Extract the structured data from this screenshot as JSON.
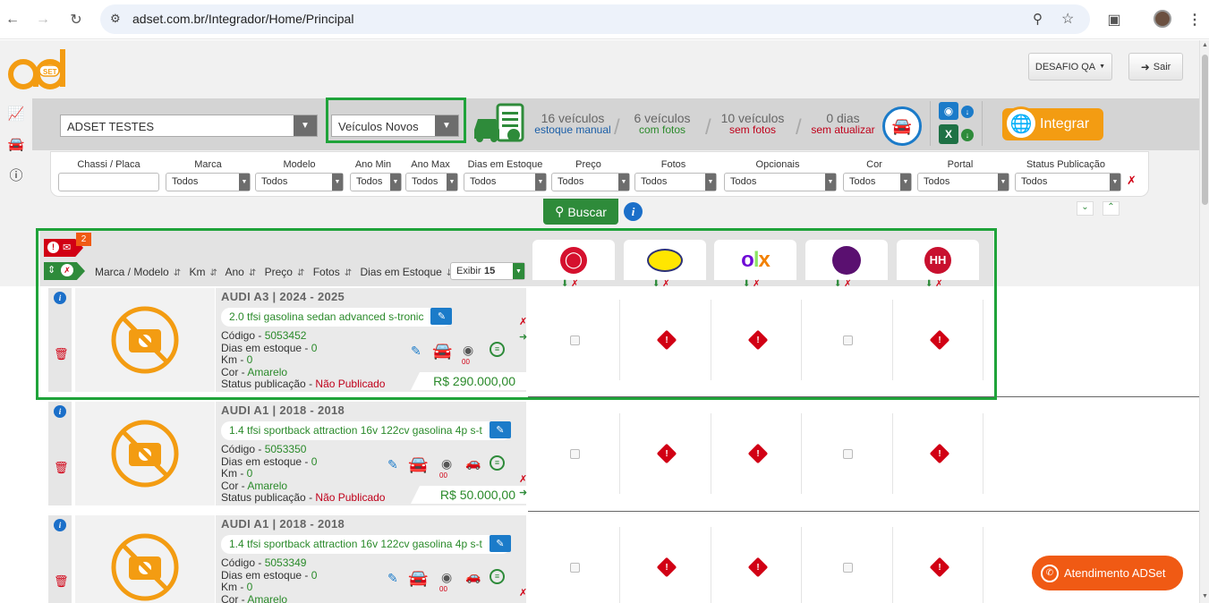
{
  "browser": {
    "url": "adset.com.br/Integrador/Home/Principal"
  },
  "header": {
    "account_menu": "DESAFIO QA",
    "logout": "Sair",
    "logo_text": "SET"
  },
  "toolbar": {
    "store_select": "ADSET TESTES",
    "vehicle_type_select": "Veículos Novos",
    "stats": [
      {
        "number": "16 veículos",
        "label": "estoque manual",
        "color": "#1b5fa8"
      },
      {
        "number": "6 veículos",
        "label": "com fotos",
        "color": "#2a8a2a"
      },
      {
        "number": "10 veículos",
        "label": "sem fotos",
        "color": "#c0001a"
      },
      {
        "number": "0 dias",
        "label": "sem atualizar",
        "color": "#c0001a"
      }
    ],
    "integrate_label": "Integrar"
  },
  "filters": {
    "labels": [
      "Chassi / Placa",
      "Marca",
      "Modelo",
      "Ano Min",
      "Ano Max",
      "Dias em Estoque",
      "Preço",
      "Fotos",
      "Opcionais",
      "Cor",
      "Portal",
      "Status Publicação"
    ],
    "chassi_value": "",
    "default_value": "Todos",
    "search_label": "Buscar"
  },
  "grid": {
    "badge_count": "2",
    "columns": [
      "Marca / Modelo",
      "Km",
      "Ano",
      "Preço",
      "Fotos",
      "Dias em Estoque"
    ],
    "show_label": "Exibir",
    "show_value": "15",
    "portals": [
      "webmotors-icon",
      "mercadolivre-icon",
      "olx-icon",
      "seusite-icon",
      "hh-icon"
    ]
  },
  "vehicles": [
    {
      "title": "AUDI A3 | 2024 - 2025",
      "description": "2.0 tfsi gasolina sedan advanced s-tronic",
      "codigo_label": "Código - ",
      "codigo": "5053452",
      "dias_label": "Dias em estoque - ",
      "dias": "0",
      "km_label": "Km - ",
      "km": "0",
      "cor_label": "Cor - ",
      "cor": "Amarelo",
      "status_label": "Status publicação - ",
      "status": "Não Publicado",
      "price": "R$ 290.000,00",
      "photos": "00"
    },
    {
      "title": "AUDI A1 | 2018 - 2018",
      "description": "1.4 tfsi sportback attraction 16v 122cv gasolina 4p s-t",
      "codigo_label": "Código - ",
      "codigo": "5053350",
      "dias_label": "Dias em estoque - ",
      "dias": "0",
      "km_label": "Km - ",
      "km": "0",
      "cor_label": "Cor - ",
      "cor": "Amarelo",
      "status_label": "Status publicação - ",
      "status": "Não Publicado",
      "price": "R$ 50.000,00",
      "photos": "00"
    },
    {
      "title": "AUDI A1 | 2018 - 2018",
      "description": "1.4 tfsi sportback attraction 16v 122cv gasolina 4p s-t",
      "codigo_label": "Código - ",
      "codigo": "5053349",
      "dias_label": "Dias em estoque - ",
      "dias": "0",
      "km_label": "Km - ",
      "km": "0",
      "cor_label": "Cor - ",
      "cor": "Amarelo",
      "status_label": "",
      "status": "",
      "price": "",
      "photos": "00"
    }
  ],
  "support": {
    "label": "Atendimento ADSet"
  },
  "colors": {
    "brand_orange": "#f39c12",
    "highlight_green": "#1fa33a",
    "action_green": "#2e8b3a",
    "alert_red": "#d10014"
  }
}
